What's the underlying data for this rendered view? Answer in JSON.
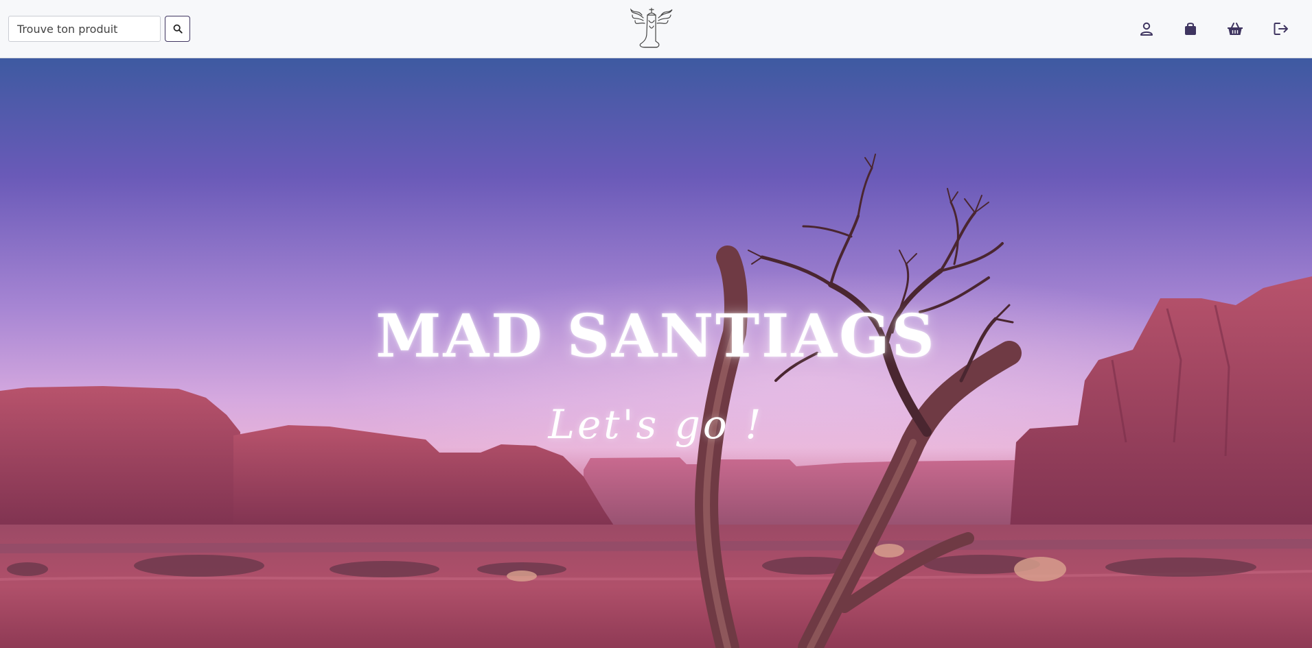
{
  "header": {
    "search": {
      "placeholder": "Trouve ton produit"
    },
    "logo": {
      "icon": "winged-cowboy-boot-logo"
    },
    "icons": [
      "user-icon",
      "shopping-bag-icon",
      "basket-icon",
      "logout-icon"
    ]
  },
  "hero": {
    "title": "MAD SANTIAGS",
    "subtitle": "Let's go !"
  },
  "colors": {
    "accent": "#3f3560",
    "sky_top": "#3e5aa1",
    "sky_mid": "#a685d3",
    "rock": "#a8465e",
    "ground": "#b0506a"
  }
}
